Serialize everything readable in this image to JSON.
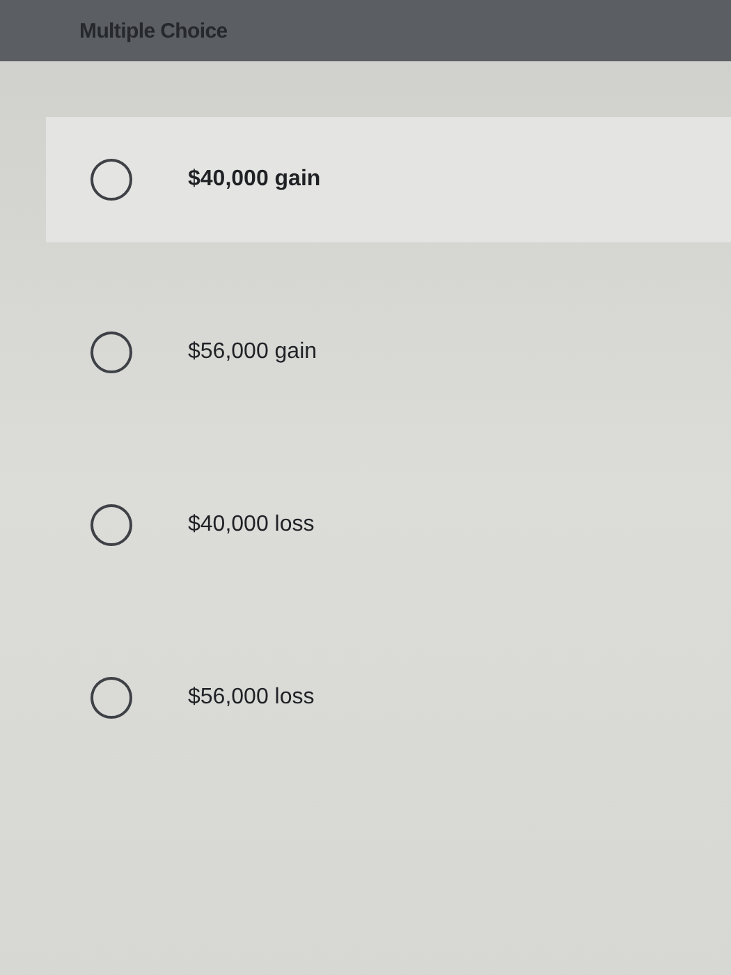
{
  "header": {
    "title": "Multiple Choice"
  },
  "options": [
    {
      "label": "$40,000 gain",
      "selected": false,
      "highlighted": true
    },
    {
      "label": "$56,000 gain",
      "selected": false,
      "highlighted": false
    },
    {
      "label": "$40,000 loss",
      "selected": false,
      "highlighted": false
    },
    {
      "label": "$56,000 loss",
      "selected": false,
      "highlighted": false
    }
  ]
}
